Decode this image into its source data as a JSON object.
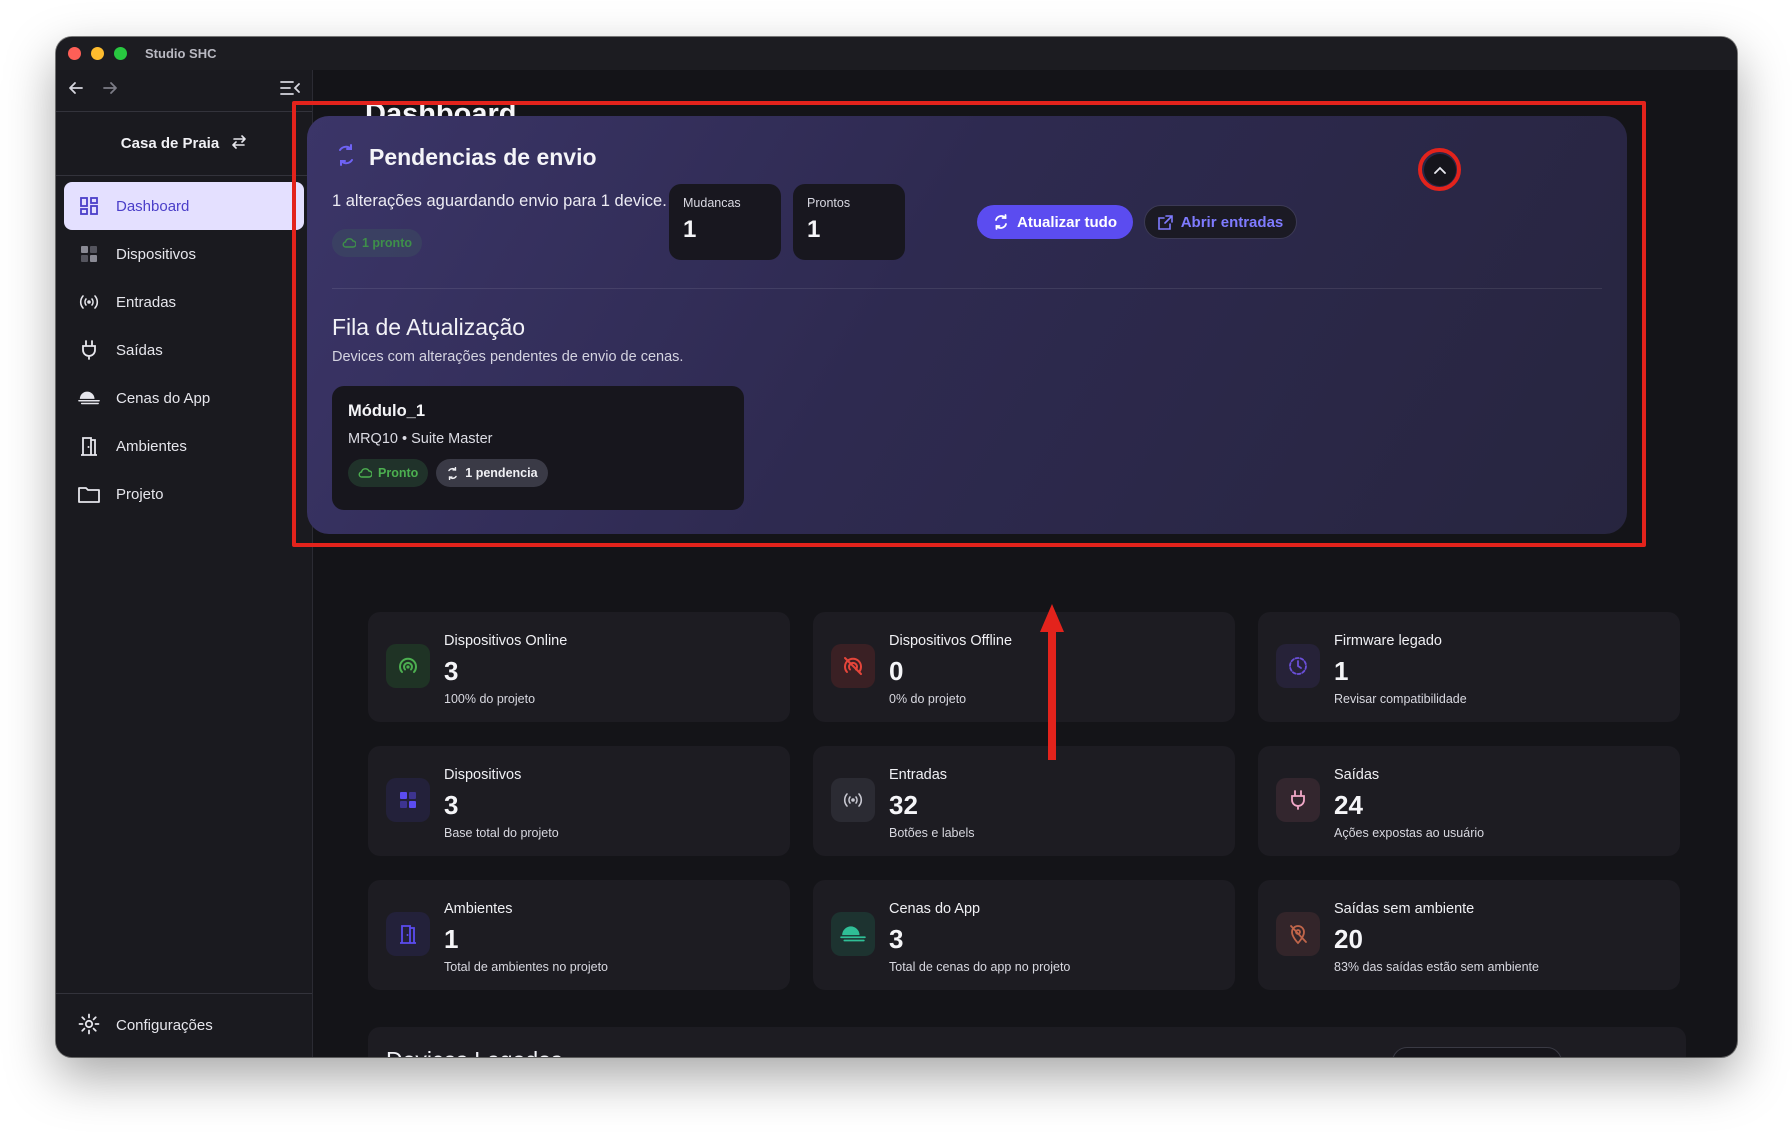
{
  "window": {
    "title": "Studio SHC"
  },
  "sidebar": {
    "house_name": "Casa de Praia",
    "items": [
      {
        "label": "Dashboard",
        "icon": "dashboard-icon",
        "active": true
      },
      {
        "label": "Dispositivos",
        "icon": "devices-grid-icon",
        "active": false
      },
      {
        "label": "Entradas",
        "icon": "broadcast-icon",
        "active": false
      },
      {
        "label": "Saídas",
        "icon": "plug-icon",
        "active": false
      },
      {
        "label": "Cenas do App",
        "icon": "scene-icon",
        "active": false
      },
      {
        "label": "Ambientes",
        "icon": "door-icon",
        "active": false
      },
      {
        "label": "Projeto",
        "icon": "folder-icon",
        "active": false
      }
    ],
    "settings_label": "Configurações"
  },
  "page": {
    "title": "Dashboard"
  },
  "pending": {
    "title": "Pendencias de envio",
    "description": "1 alterações aguardando envio para 1 device.",
    "ready_chip": "1 pronto",
    "stats": [
      {
        "label": "Mudancas",
        "value": "1"
      },
      {
        "label": "Prontos",
        "value": "1"
      }
    ],
    "update_all_label": "Atualizar tudo",
    "open_inputs_label": "Abrir entradas",
    "queue": {
      "title": "Fila de Atualização",
      "subtitle": "Devices com alterações pendentes de envio de cenas.",
      "modules": [
        {
          "name": "Módulo_1",
          "subtitle": "MRQ10 • Suite Master",
          "status": "Pronto",
          "pending": "1 pendencia"
        }
      ]
    }
  },
  "kpis": [
    {
      "label": "Dispositivos Online",
      "value": "3",
      "sub": "100% do projeto",
      "icon": "signal-online-icon",
      "color": "#4caf50"
    },
    {
      "label": "Dispositivos Offline",
      "value": "0",
      "sub": "0% do projeto",
      "icon": "signal-offline-icon",
      "color": "#e5453a"
    },
    {
      "label": "Firmware legado",
      "value": "1",
      "sub": "Revisar compatibilidade",
      "icon": "history-icon",
      "color": "#6a4fd8"
    },
    {
      "label": "Dispositivos",
      "value": "3",
      "sub": "Base total do projeto",
      "icon": "devices-grid-icon",
      "color": "#5b4cf0"
    },
    {
      "label": "Entradas",
      "value": "32",
      "sub": "Botões e labels",
      "icon": "broadcast-icon",
      "color": "#c7c7d0"
    },
    {
      "label": "Saídas",
      "value": "24",
      "sub": "Ações expostas ao usuário",
      "icon": "plug-icon",
      "color": "#f2a8c8"
    },
    {
      "label": "Ambientes",
      "value": "1",
      "sub": "Total de ambientes no projeto",
      "icon": "door-icon",
      "color": "#5b4cf0"
    },
    {
      "label": "Cenas do App",
      "value": "3",
      "sub": "Total de cenas do app no projeto",
      "icon": "scene-icon",
      "color": "#2fbf96"
    },
    {
      "label": "Saídas sem ambiente",
      "value": "20",
      "sub": "83% das saídas estão sem ambiente",
      "icon": "location-off-icon",
      "color": "#c0654a"
    }
  ],
  "bottom": {
    "title": "Devices Legados"
  },
  "colors": {
    "accent": "#5b4cf0",
    "annotation": "#e3231c",
    "success": "#4caf50"
  }
}
